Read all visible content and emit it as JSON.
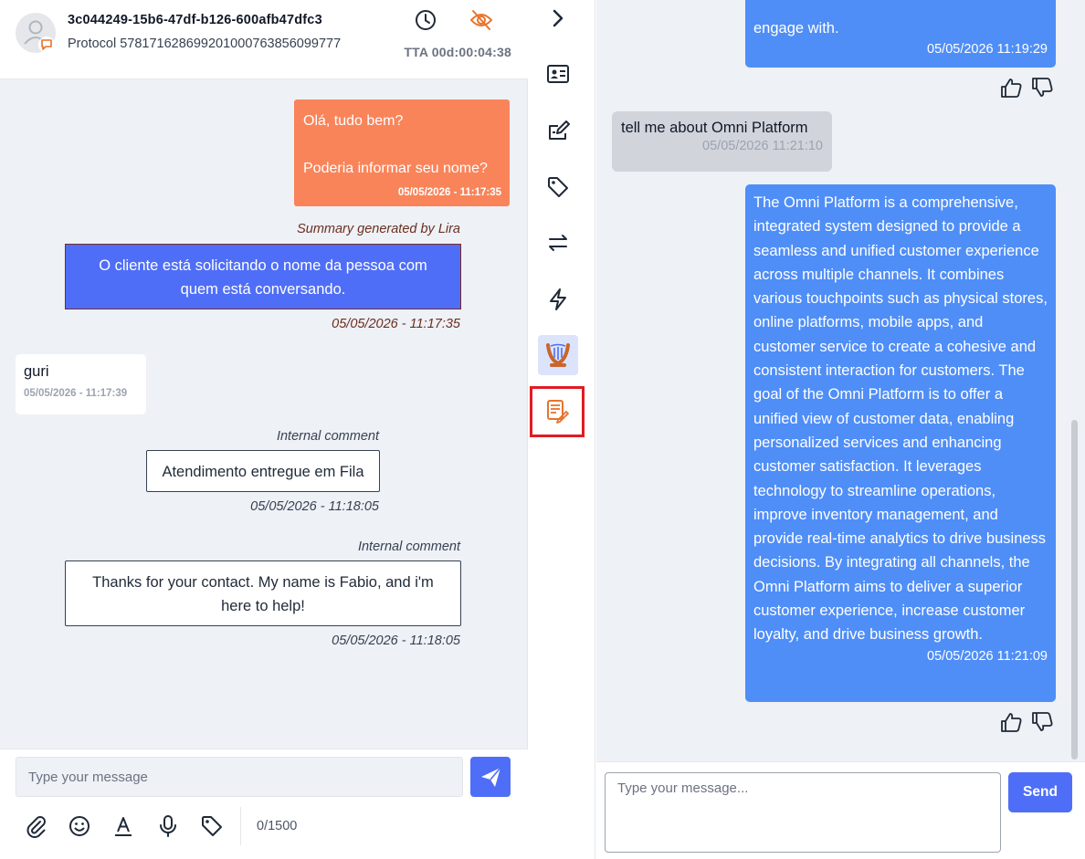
{
  "conversation": {
    "id": "3c044249-15b6-47df-b126-600afb47dfc3",
    "protocol": "Protocol 57817162869920100076385609977​7",
    "tta": "TTA 00d:00:04:38",
    "accent_color": "#e8732c"
  },
  "messages": {
    "agent_greeting_line1": "Olá, tudo bem?",
    "agent_greeting_line2": "Poderia informar seu nome?",
    "agent_greeting_time": "05/05/2026 - 11:17:35",
    "summary_label": "Summary generated by Lira",
    "summary_text": "O cliente está solicitando o nome da pessoa com quem está conversando.",
    "summary_time": "05/05/2026 - 11:17:35",
    "customer_text": "guri",
    "customer_time": "05/05/2026 - 11:17:39",
    "comment1_label": "Internal comment",
    "comment1_text": "Atendimento entregue em Fila",
    "comment1_time": "05/05/2026 - 11:18:05",
    "comment2_label": "Internal comment",
    "comment2_text": "Thanks for your contact. My name is Fabio, and i'm here to help!",
    "comment2_time": "05/05/2026 - 11:18:05"
  },
  "composer": {
    "placeholder": "Type your message",
    "char_count": "0/1500"
  },
  "rail": {
    "icons": [
      "chevron-right-icon",
      "contact-card-icon",
      "edit-icon",
      "tag-icon",
      "transfer-icon",
      "lightning-icon",
      "lira-logo",
      "notes-icon"
    ]
  },
  "lira_chat": {
    "msg1_text": "engage with.",
    "msg1_time": "05/05/2026 11:19:29",
    "user_text": "tell me about Omni Platform",
    "user_time": "05/05/2026 11:21:10",
    "msg2_text": "The Omni Platform is a comprehensive, integrated system designed to provide a seamless and unified customer experience across multiple channels. It combines various touchpoints such as physical stores, online platforms, mobile apps, and customer service to create a cohesive and consistent interaction for customers. The goal of the Omni Platform is to offer a unified view of customer data, enabling personalized services and enhancing customer satisfaction. It leverages technology to streamline operations, improve inventory management, and provide real-time analytics to drive business decisions. By integrating all channels, the Omni Platform aims to deliver a superior customer experience, increase customer loyalty, and drive business growth.",
    "msg2_time": "05/05/2026 11:21:09",
    "input_placeholder": "Type your message...",
    "send_label": "Send"
  },
  "colors": {
    "primary_blue": "#4f6ef7",
    "bot_bubble": "#4f8ef7",
    "agent_bubble": "#f9845a",
    "highlight_red": "#e01b24"
  }
}
